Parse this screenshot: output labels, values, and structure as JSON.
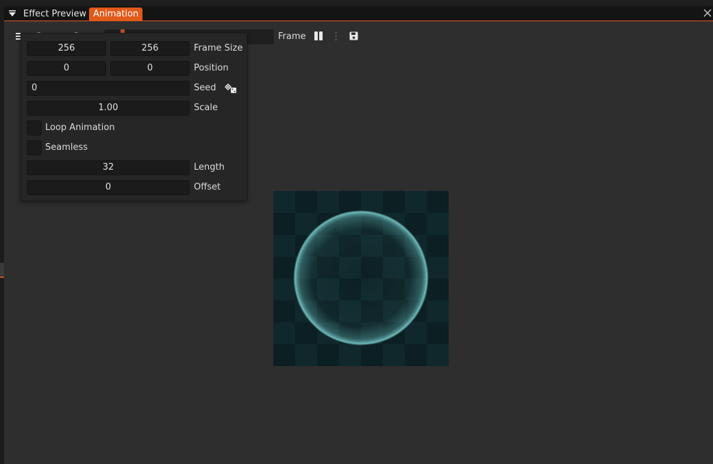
{
  "tabs": {
    "effect_preview": "Effect Preview",
    "animation": "Animation"
  },
  "toolbar": {
    "frame_label": "Frame",
    "icons": [
      "list-icon",
      "rotate-ccw-icon",
      "folder-icon",
      "redo-icon",
      "pause-icon",
      "more-icon",
      "save-icon"
    ],
    "slider_value_fraction": 0.1
  },
  "popup": {
    "frame_size_label": "Frame Size",
    "frame_width": "256",
    "frame_height": "256",
    "position_label": "Position",
    "position_x": "0",
    "position_y": "0",
    "seed_label": "Seed",
    "seed_value": "0",
    "scale_label": "Scale",
    "scale_value": "1.00",
    "loop_label": "Loop Animation",
    "loop_checked": false,
    "seamless_label": "Seamless",
    "seamless_checked": false,
    "length_label": "Length",
    "length_value": "32",
    "offset_label": "Offset",
    "offset_value": "0"
  },
  "colors": {
    "accent": "#e05a1a",
    "background": "#2e2e2e",
    "preview_glow": "#5fb3b3"
  }
}
